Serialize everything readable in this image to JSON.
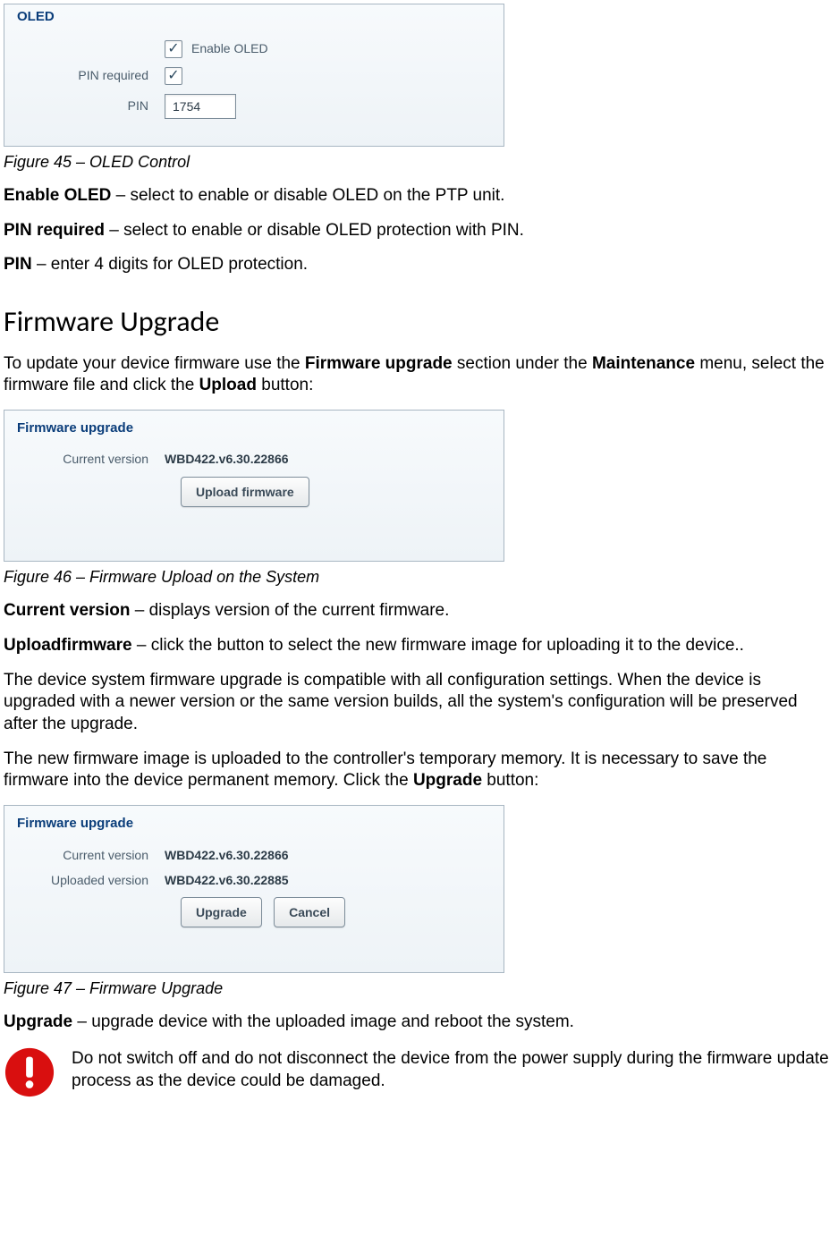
{
  "oled": {
    "panel_title": "OLED",
    "enable_label": "Enable OLED",
    "pin_required_label": "PIN required",
    "pin_label": "PIN",
    "pin_value": "1754"
  },
  "captions": {
    "fig45": "Figure 45 – OLED Control",
    "fig46": "Figure 46 – Firmware Upload on the System",
    "fig47": "Figure 47 – Firmware Upgrade"
  },
  "desc": {
    "enable_oled_b": "Enable OLED",
    "enable_oled_t": " – select to enable or disable OLED on the PTP unit.",
    "pin_req_b": "PIN required",
    "pin_req_t": " – select to enable or disable OLED protection with PIN.",
    "pin_b": "PIN",
    "pin_t": " – enter 4 digits for OLED protection.",
    "curver_b": "Current version",
    "curver_t": " – displays version of the current firmware.",
    "upfw_b": "Uploadfirmware",
    "upfw_t": " – click the button to select the new firmware image for uploading it to the device..",
    "compat": "The device system firmware upgrade is compatible with all configuration settings. When the device is upgraded with a newer version or the same version builds, all the system's configuration will be preserved after the upgrade.",
    "newimg_a": "The new firmware image is uploaded to the controller's temporary memory. It is necessary to save the firmware into the device permanent memory. Click the ",
    "newimg_b": "Upgrade",
    "newimg_c": " button:",
    "upgrade_b": "Upgrade",
    "upgrade_t": " – upgrade device with the uploaded image and reboot the system.",
    "warn": "Do not switch off and do not disconnect the device from the power supply during the firmware update process as the device could be damaged."
  },
  "fw_section": {
    "heading": "Firmware Upgrade",
    "intro_a": "To update your device firmware use the ",
    "intro_b1": "Firmware upgrade",
    "intro_c": " section under the ",
    "intro_b2": "Maintenance",
    "intro_d": " menu, select the firmware file and click the ",
    "intro_b3": "Upload",
    "intro_e": " button:"
  },
  "fw_panel1": {
    "title": "Firmware upgrade",
    "curver_label": "Current version",
    "curver_value": "WBD422.v6.30.22866",
    "upload_btn": "Upload firmware"
  },
  "fw_panel2": {
    "title": "Firmware upgrade",
    "curver_label": "Current version",
    "curver_value": "WBD422.v6.30.22866",
    "upver_label": "Uploaded version",
    "upver_value": "WBD422.v6.30.22885",
    "upgrade_btn": "Upgrade",
    "cancel_btn": "Cancel"
  }
}
